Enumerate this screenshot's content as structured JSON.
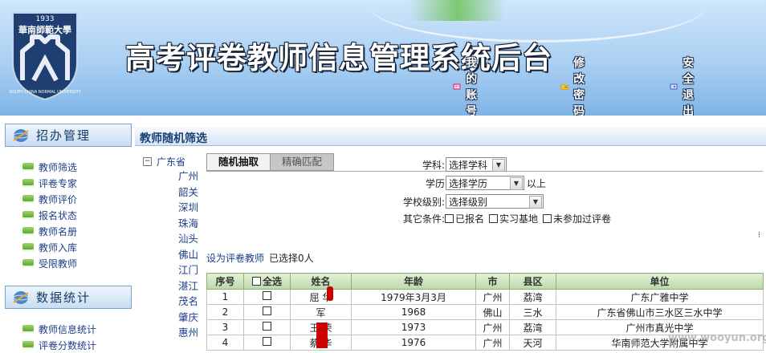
{
  "header": {
    "title": "高考评卷教师信息管理系统后台",
    "logo": {
      "year": "1933",
      "name_cn": "華南師範大學",
      "name_en": "SOUTH CHINA NORMAL UNIVERSITY"
    },
    "links": [
      {
        "label": "我的账号",
        "icon": "account-icon"
      },
      {
        "label": "修改密码",
        "icon": "folder-key-icon"
      },
      {
        "label": "安全退出",
        "icon": "exit-icon"
      }
    ]
  },
  "sidebar": {
    "sections": [
      {
        "title": "招办管理",
        "items": [
          "教师筛选",
          "评卷专家",
          "教师评价",
          "报名状态",
          "教师名册",
          "教师入库",
          "受限教师"
        ]
      },
      {
        "title": "数据统计",
        "items": [
          "教师信息统计",
          "评卷分数统计"
        ]
      }
    ]
  },
  "content": {
    "page_title": "教师随机筛选",
    "tree": {
      "root": "广东省",
      "cities": [
        "广州",
        "韶关",
        "深圳",
        "珠海",
        "汕头",
        "佛山",
        "江门",
        "湛江",
        "茂名",
        "肇庆",
        "惠州"
      ]
    },
    "tabs": [
      "随机抽取",
      "精确匹配"
    ],
    "filters": {
      "subject_label": "学科:",
      "subject_value": "选择学科",
      "edu_label": "学历",
      "edu_value": "选择学历",
      "edu_suffix": "以上",
      "level_label": "学校级别:",
      "level_value": "选择级别",
      "other_label": "其它条件:",
      "options": [
        "已报名",
        "实习基地",
        "未参加过评卷"
      ]
    },
    "assign": {
      "link": "设为评卷教师",
      "selected_prefix": "已选择",
      "selected_count": "0",
      "selected_suffix": "人"
    },
    "table": {
      "headers": {
        "no": "序号",
        "select_all": "全选",
        "name": "姓名",
        "age": "年龄",
        "city": "市",
        "district": "县区",
        "unit": "单位"
      },
      "rows": [
        {
          "no": "1",
          "name": "屈   华",
          "age": "1979年3月3月",
          "city": "广州",
          "district": "荔湾",
          "unit": "广东广雅中学"
        },
        {
          "no": "2",
          "name": "   军",
          "age": "1968",
          "city": "佛山",
          "district": "三水",
          "unit": "广东省佛山市三水区三水中学"
        },
        {
          "no": "3",
          "name": "王  荣",
          "age": "1973",
          "city": "广州",
          "district": "荔湾",
          "unit": "广州市真光中学"
        },
        {
          "no": "4",
          "name": "蔡  华",
          "age": "1976",
          "city": "广州",
          "district": "天河",
          "unit": "华南师范大学附属中学"
        }
      ]
    }
  },
  "watermark": "www.wooyun.org",
  "colors": {
    "header_top": "#cfe6fb",
    "header_bottom": "#7fb4e6",
    "sidebar_border": "#7aa5cf",
    "table_header": "#bcd9a8",
    "link": "#1c3e8a"
  }
}
